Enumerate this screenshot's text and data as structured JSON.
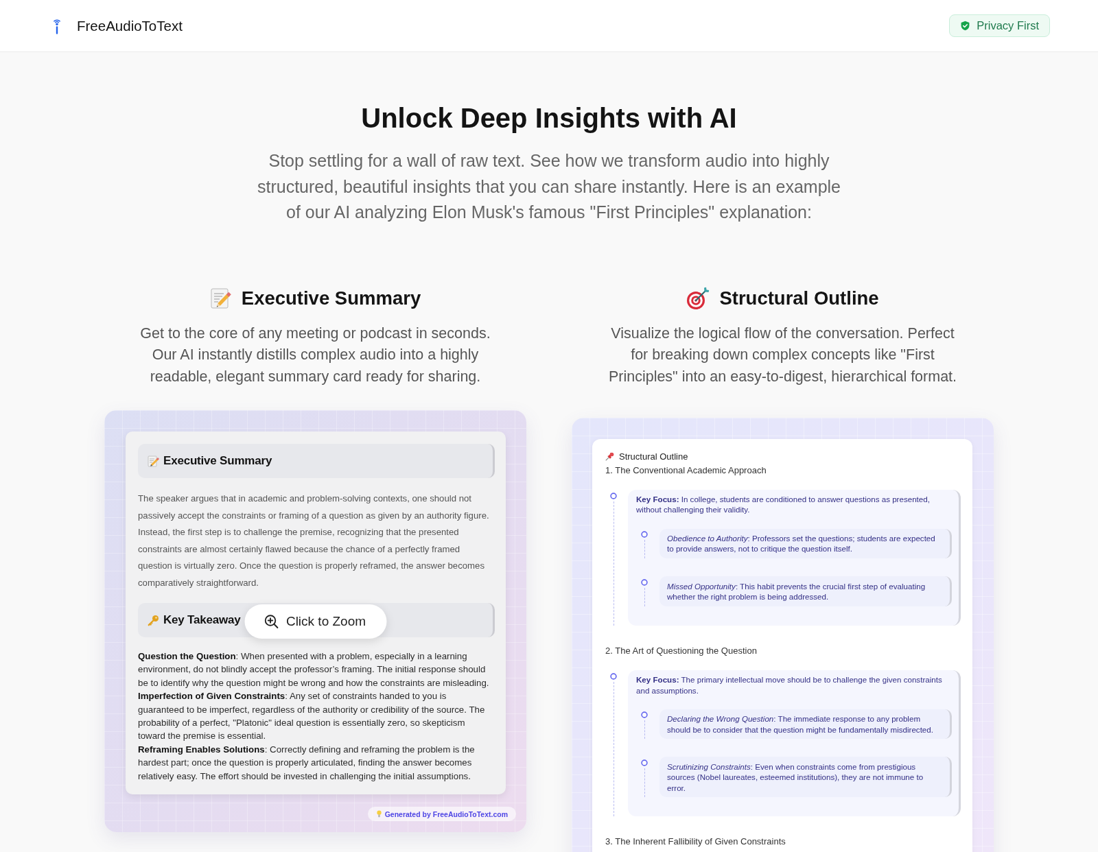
{
  "header": {
    "brand": "FreeAudioToText",
    "badge": "Privacy First"
  },
  "hero": {
    "title": "Unlock Deep Insights with AI",
    "subtitle": "Stop settling for a wall of raw text. See how we transform audio into highly structured, beautiful insights that you can share instantly. Here is an example of our AI analyzing Elon Musk's famous \"First Principles\" explanation:"
  },
  "features": [
    {
      "kind": "summary",
      "title": "Executive Summary",
      "description": "Get to the core of any meeting or podcast in seconds. Our AI instantly distills complex audio into a highly readable, elegant summary card ready for sharing.",
      "preview": {
        "sections": [
          {
            "kind": "paragraph",
            "title": "Executive Summary",
            "body": "The speaker argues that in academic and problem-solving contexts, one should not passively accept the constraints or framing of a question as given by an authority figure. Instead, the first step is to challenge the premise, recognizing that the presented constraints are almost certainly flawed because the chance of a perfectly framed question is virtually zero. Once the question is properly reframed, the answer becomes comparatively straightforward."
          },
          {
            "kind": "points",
            "title": "Key Takeaway",
            "points": [
              "**Question the Question**: When presented with a problem, especially in a learning environment, do not blindly accept the professor’s framing. The initial response should be to identify why the question might be wrong and how the constraints are misleading.",
              "**Imperfection of Given Constraints**: Any set of constraints handed to you is guaranteed to be imperfect, regardless of the authority or credibility of the source. The probability of a perfect, \"Platonic\" ideal question is essentially zero, so skepticism toward the premise is essential.",
              "**Reframing Enables Solutions**: Correctly defining and reframing the problem is the hardest part; once the question is properly articulated, finding the answer becomes relatively easy. The effort should be invested in challenging the initial assumptions."
            ]
          }
        ],
        "zoom_button": "Click to Zoom",
        "credit": "Generated by FreeAudioToText.com"
      }
    },
    {
      "kind": "outline",
      "title": "Structural Outline",
      "description": "Visualize the logical flow of the conversation. Perfect for breaking down complex concepts like \"First Principles\" into an easy-to-digest, hierarchical format.",
      "preview": {
        "title": "Structural Outline",
        "items": [
          {
            "heading": "1. The Conventional Academic Approach",
            "focus": "**Key Focus:** In college, students are conditioned to answer questions as presented, without challenging their validity.",
            "children": [
              {
                "text": "*Obedience to Authority*: Professors set the questions; students are expected to provide answers, not to critique the question itself."
              },
              {
                "text": "*Missed Opportunity*: This habit prevents the crucial first step of evaluating whether the right problem is being addressed."
              }
            ]
          },
          {
            "heading": "2. The Art of Questioning the Question",
            "focus": "**Key Focus:** The primary intellectual move should be to challenge the given constraints and assumptions.",
            "children": [
              {
                "text": "*Declaring the Wrong Question*: The immediate response to any problem should be to consider that the question might be fundamentally misdirected."
              },
              {
                "text": "*Scrutinizing Constraints*: Even when constraints come from prestigious sources (Nobel laureates, esteemed institutions), they are not immune to error."
              }
            ]
          },
          {
            "heading": "3. The Inherent Fallibility of Given Constraints"
          }
        ]
      }
    }
  ]
}
